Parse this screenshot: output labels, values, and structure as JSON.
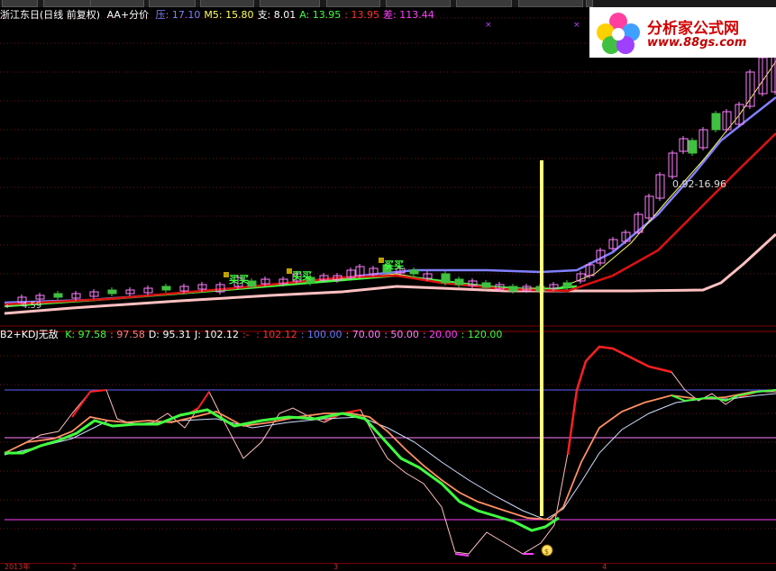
{
  "main_header": {
    "title": "浙江东日(日线 前复权)",
    "indicator": "AA+分价",
    "items": [
      {
        "label": "压:",
        "value": "17.10",
        "color": "#8080ff"
      },
      {
        "label": "M5:",
        "value": "15.80",
        "color": "#ffff60"
      },
      {
        "label": "支:",
        "value": "8.01",
        "color": "#ffffff"
      },
      {
        "label": "A:",
        "value": "13.95",
        "color": "#40ff40"
      },
      {
        "label": ":",
        "value": "13.95",
        "color": "#ff3030"
      },
      {
        "label": "差:",
        "value": "113.44",
        "color": "#ff40ff"
      }
    ]
  },
  "sub_header": {
    "title": "B2+KDJ无敌",
    "items": [
      {
        "label": "K:",
        "value": "97.58",
        "color": "#40ff40"
      },
      {
        "label": ":",
        "value": "97.58",
        "color": "#ff8080"
      },
      {
        "label": "D:",
        "value": "95.31",
        "color": "#ffffff"
      },
      {
        "label": "J:",
        "value": "102.12",
        "color": "#ffffff"
      },
      {
        "label": ":-",
        "value": "",
        "color": "#ff3030"
      },
      {
        "label": ":",
        "value": "102.12",
        "color": "#ff3030"
      },
      {
        "label": ":",
        "value": "100.00",
        "color": "#6080ff"
      },
      {
        "label": ":",
        "value": "70.00",
        "color": "#ff80ff"
      },
      {
        "label": ":",
        "value": "50.00",
        "color": "#ff80ff"
      },
      {
        "label": ":",
        "value": "20.00",
        "color": "#ff40ff"
      },
      {
        "label": ":",
        "value": "120.00",
        "color": "#40ff40"
      }
    ]
  },
  "logo": {
    "name": "分析家公式网",
    "url": "www.88gs.com"
  },
  "annotations": {
    "low_price": "4.59",
    "range_label": "0.92-16.96",
    "signal_label": "买"
  },
  "colors": {
    "up_candle": "#ff80ff",
    "down_candle": "#40c040",
    "red_line": "#dd1111",
    "pink_line": "#ffc0c0",
    "blue_line": "#8080ff",
    "green_line": "#40ff40",
    "vertical_marker": "#ffff80"
  },
  "bottom_axis": {
    "labels": [
      "2013年",
      "2",
      "3",
      "4"
    ]
  }
}
